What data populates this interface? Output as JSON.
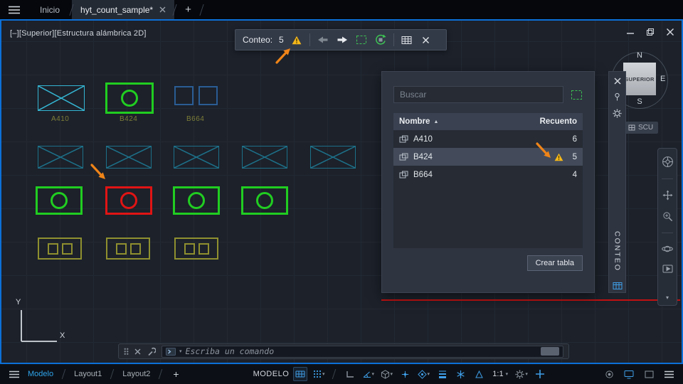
{
  "tab_bar": {
    "start_tab": "Inicio",
    "drawing_tab": "hyt_count_sample*",
    "new_tab": "+"
  },
  "viewport_label": "[–][Superior][Estructura alámbrica 2D]",
  "count_toolbar": {
    "label": "Conteo:",
    "count": "5"
  },
  "blocks": {
    "a410": "A410",
    "b424": "B424",
    "b664": "B664"
  },
  "palette": {
    "search_placeholder": "Buscar",
    "name_header": "Nombre",
    "count_header": "Recuento",
    "rows": [
      {
        "name": "A410",
        "count": "6"
      },
      {
        "name": "B424",
        "count": "5"
      },
      {
        "name": "B664",
        "count": "4"
      }
    ],
    "create_table_label": "Crear tabla",
    "title": "CONTEO"
  },
  "viewcube": {
    "north": "N",
    "east": "E",
    "south": "S",
    "top_face": "SUPERIOR",
    "ucs_label": "SCU"
  },
  "ucs_axes": {
    "x": "X",
    "y": "Y"
  },
  "command_line": {
    "placeholder": "Escriba un comando"
  },
  "status_bar": {
    "model_tab": "Modelo",
    "layout1_tab": "Layout1",
    "layout2_tab": "Layout2",
    "new_layout": "+",
    "space_label": "MODELO",
    "scale": "1:1"
  },
  "colors": {
    "accent_blue": "#0c70d8",
    "warning_yellow": "#f5b81a",
    "arrow_orange": "#ef8418",
    "block_green": "#21cd21",
    "block_red": "#e01414",
    "block_cyan_bright": "#35b6d3",
    "block_cyan_dim": "#1d7089",
    "block_navy": "#2a5c94",
    "block_olive": "#8f8f2f"
  }
}
